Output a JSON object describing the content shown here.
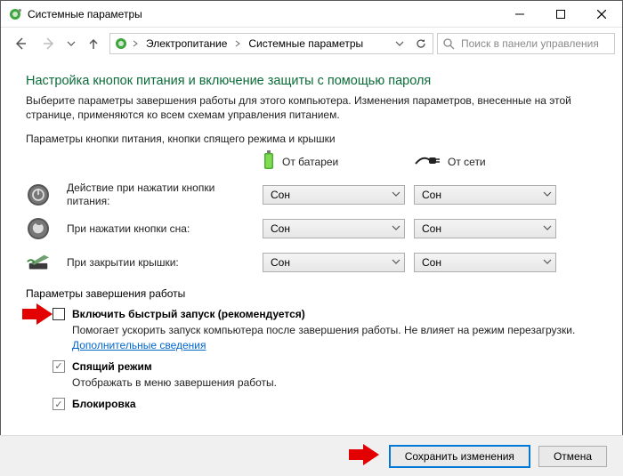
{
  "window": {
    "title": "Системные параметры"
  },
  "breadcrumb": {
    "item1": "Электропитание",
    "item2": "Системные параметры"
  },
  "search": {
    "placeholder": "Поиск в панели управления"
  },
  "main": {
    "heading": "Настройка кнопок питания и включение защиты с помощью пароля",
    "intro": "Выберите параметры завершения работы для этого компьютера. Изменения параметров, внесенные на этой странице, применяются ко всем схемам управления питанием.",
    "section1_title": "Параметры кнопки питания, кнопки спящего режима и крышки",
    "col_battery": "От батареи",
    "col_ac": "От сети",
    "rows": [
      {
        "label": "Действие при нажатии кнопки питания:",
        "battery": "Сон",
        "ac": "Сон"
      },
      {
        "label": "При нажатии кнопки сна:",
        "battery": "Сон",
        "ac": "Сон"
      },
      {
        "label": "При закрытии крышки:",
        "battery": "Сон",
        "ac": "Сон"
      }
    ],
    "section2_title": "Параметры завершения работы",
    "opts": {
      "fastboot_label": "Включить быстрый запуск (рекомендуется)",
      "fastboot_desc": "Помогает ускорить запуск компьютера после завершения работы. Не влияет на режим перезагрузки.",
      "fastboot_link": "Дополнительные сведения",
      "sleep_label": "Спящий режим",
      "sleep_desc": "Отображать в меню завершения работы.",
      "lock_label": "Блокировка"
    }
  },
  "footer": {
    "save": "Сохранить изменения",
    "cancel": "Отмена"
  }
}
